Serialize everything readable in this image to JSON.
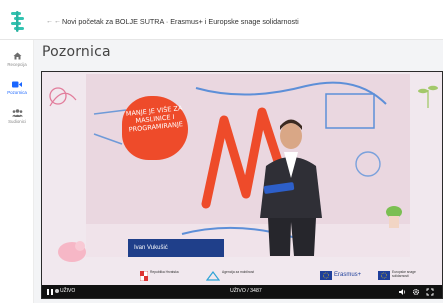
{
  "header": {
    "back_arrows": "←←",
    "breadcrumb": "Novi početak za BOLJE SUTRA · Erasmus+ i Europske snage solidarnosti"
  },
  "sidebar": {
    "items": [
      {
        "label": "Recepcija",
        "icon": "home-icon"
      },
      {
        "label": "Pozornica",
        "icon": "video-camera-icon"
      },
      {
        "label": "Sudionici",
        "icon": "people-icon"
      }
    ]
  },
  "page": {
    "title": "Pozornica"
  },
  "video": {
    "bubble_text": "MANJE JE VIŠE ZA MASLINICE I PROGRAMIRANJE",
    "presenter_name": "Ivan Vukušić",
    "partner_logos": [
      {
        "name": "Republika Hrvatska"
      },
      {
        "name": "Agencija za mobilnost"
      },
      {
        "name": "Erasmus+"
      },
      {
        "name": "Europske snage solidarnosti"
      }
    ],
    "live_label": "UŽIVO",
    "viewers_text": "UŽIVO / 3487"
  },
  "colors": {
    "accent": "#1a66ff",
    "brand_teal": "#34c3b1",
    "bubble": "#ee4b2a",
    "name_tag": "#1f3f8a"
  }
}
